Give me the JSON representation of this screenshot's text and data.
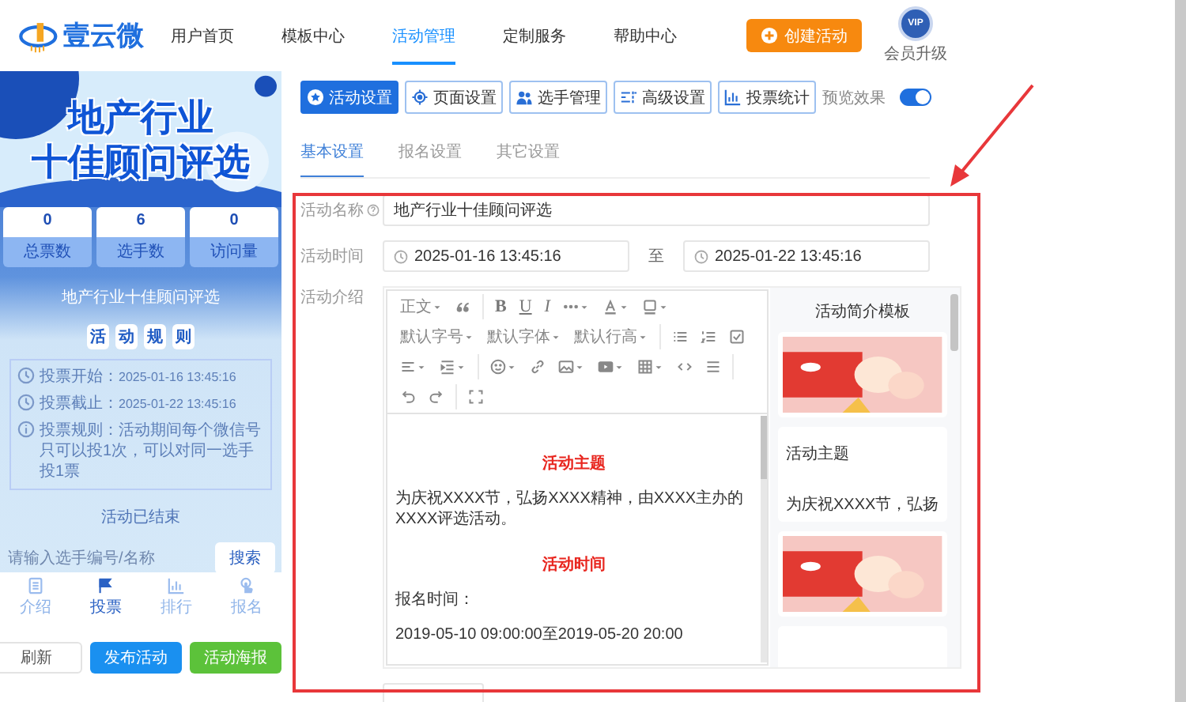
{
  "nav": {
    "logo": "壹云微",
    "items": [
      {
        "label": "用户首页",
        "selected": false
      },
      {
        "label": "模板中心",
        "selected": false
      },
      {
        "label": "活动管理",
        "selected": true
      },
      {
        "label": "定制服务",
        "selected": false
      },
      {
        "label": "帮助中心",
        "selected": false
      }
    ],
    "create_button": "创建活动",
    "vip_badge": "VIP",
    "vip_label": "会员升级"
  },
  "preview": {
    "banner_title": [
      "地产行业",
      "十佳顾问评选"
    ],
    "stats": [
      {
        "value": "0",
        "label": "总票数"
      },
      {
        "value": "6",
        "label": "选手数"
      },
      {
        "value": "0",
        "label": "访问量"
      }
    ],
    "activity_name": "地产行业十佳顾问评选",
    "rules_title": [
      "活",
      "动",
      "规",
      "则"
    ],
    "rules": [
      {
        "kind": "clock",
        "label": "投票开始：",
        "value": "2025-01-16 13:45:16"
      },
      {
        "kind": "clock",
        "label": "投票截止：",
        "value": "2025-01-22 13:45:16"
      },
      {
        "kind": "info",
        "label": "投票规则：",
        "value": "活动期间每个微信号只可以投1次，可以对同一选手投1票"
      }
    ],
    "status": "活动已结束",
    "search": {
      "placeholder": "请输入选手编号/名称",
      "button": "搜索"
    },
    "tabs": [
      {
        "label": "介绍",
        "kind": "doc",
        "selected": false
      },
      {
        "label": "投票",
        "kind": "flag",
        "selected": true
      },
      {
        "label": "排行",
        "kind": "chart",
        "selected": false
      },
      {
        "label": "报名",
        "kind": "hand",
        "selected": false
      }
    ],
    "buttons": [
      {
        "label": "刷新",
        "kind": "plain"
      },
      {
        "label": "发布活动",
        "kind": "primary"
      },
      {
        "label": "活动海报",
        "kind": "success"
      }
    ]
  },
  "toolbar": [
    {
      "label": "活动设置",
      "kind": "star",
      "selected": true
    },
    {
      "label": "页面设置",
      "kind": "gear",
      "selected": false
    },
    {
      "label": "选手管理",
      "kind": "users",
      "selected": false
    },
    {
      "label": "高级设置",
      "kind": "sliders",
      "selected": false
    },
    {
      "label": "投票统计",
      "kind": "chart",
      "selected": false
    }
  ],
  "preview_toggle": {
    "label": "预览效果",
    "on": true
  },
  "subtabs": [
    {
      "label": "基本设置",
      "selected": true
    },
    {
      "label": "报名设置",
      "selected": false
    },
    {
      "label": "其它设置",
      "selected": false
    }
  ],
  "form": {
    "name": {
      "label": "活动名称",
      "value": "地产行业十佳顾问评选"
    },
    "time": {
      "label": "活动时间",
      "start": "2025-01-16 13:45:16",
      "separator": "至",
      "end": "2025-01-22 13:45:16"
    },
    "intro": {
      "label": "活动介绍"
    }
  },
  "editor": {
    "dropdowns": [
      "正文",
      "默认字号",
      "默认字体",
      "默认行高"
    ],
    "format_buttons": [
      {
        "label": "B",
        "kind": "bold"
      },
      {
        "label": "U",
        "kind": "underline"
      },
      {
        "label": "I",
        "kind": "italic"
      }
    ],
    "content": [
      {
        "kind": "heading",
        "text": "活动主题"
      },
      {
        "kind": "paragraph",
        "text": "为庆祝XXXX节，弘扬XXXX精神，由XXXX主办的XXXX评选活动。"
      },
      {
        "kind": "heading",
        "text": "活动时间"
      },
      {
        "kind": "paragraph",
        "text": "报名时间："
      },
      {
        "kind": "paragraph",
        "text": "2019-05-10 09:00:00至2019-05-20 20:00"
      }
    ]
  },
  "templates": {
    "title": "活动简介模板",
    "cards": [
      {
        "kind": "picture"
      },
      {
        "kind": "text",
        "title": "活动主题",
        "body": "为庆祝XXXX节，弘扬"
      },
      {
        "kind": "picture"
      },
      {
        "kind": "blank"
      }
    ]
  }
}
